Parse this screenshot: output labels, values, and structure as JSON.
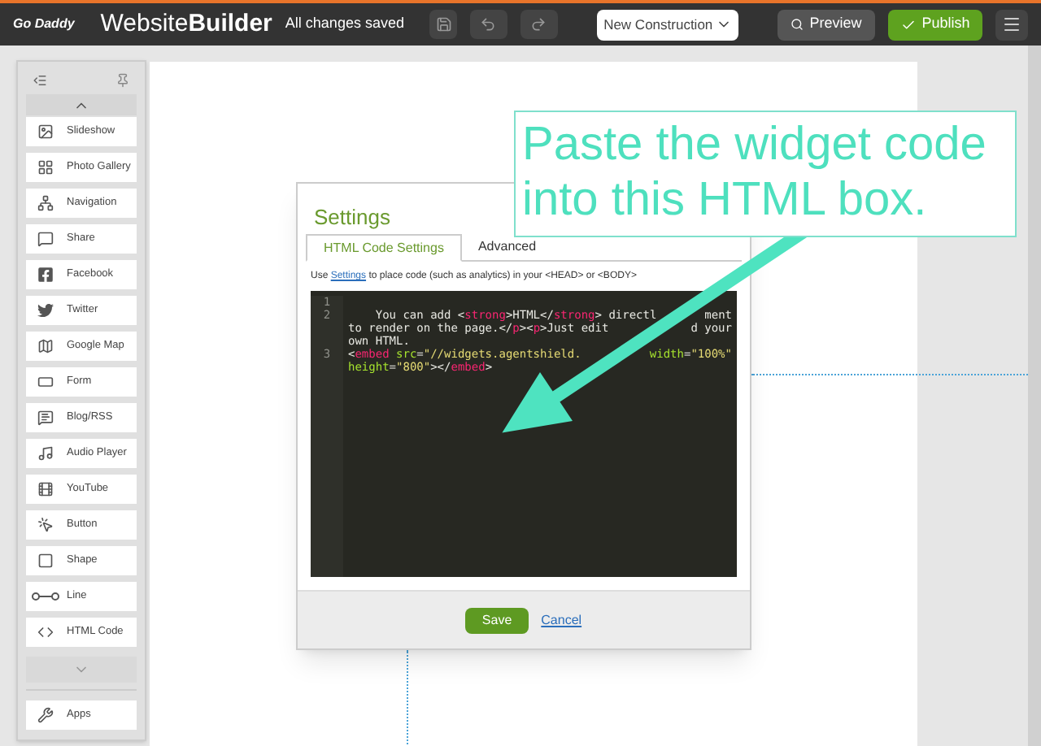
{
  "topbar": {
    "logo": "Go Daddy",
    "title": "Website**Builder**",
    "status": "All changes saved",
    "page_select": "New Construction",
    "preview": "Preview",
    "publish": "Publish"
  },
  "panel": {
    "items": [
      {
        "label": "Slideshow"
      },
      {
        "label": "Photo Gallery"
      },
      {
        "label": "Navigation"
      },
      {
        "label": "Share"
      },
      {
        "label": "Facebook"
      },
      {
        "label": "Twitter"
      },
      {
        "label": "Google Map"
      },
      {
        "label": "Form"
      },
      {
        "label": "Blog/RSS"
      },
      {
        "label": "Audio Player"
      },
      {
        "label": "YouTube"
      },
      {
        "label": "Button"
      },
      {
        "label": "Shape"
      },
      {
        "label": "Line"
      },
      {
        "label": "HTML Code"
      }
    ],
    "apps": "Apps"
  },
  "dialog": {
    "title": "Settings",
    "tabs": [
      {
        "label": "HTML Code Settings",
        "selected": true
      },
      {
        "label": "Advanced",
        "selected": false
      }
    ],
    "hint_before": "Use ",
    "hint_link": "Settings",
    "hint_after": " to place code (such as analytics) in your <HEAD> or <BODY>",
    "code_lines": [
      {
        "number": "1"
      },
      {
        "number": "2",
        "segments": [
          {
            "kind": "text",
            "text": "    You can add <"
          },
          {
            "kind": "tag",
            "text": "strong"
          },
          {
            "kind": "text",
            "text": ">HTML</"
          },
          {
            "kind": "tag",
            "text": "strong"
          },
          {
            "kind": "text",
            "text": "> directl"
          }
        ],
        "tail": [
          {
            "kind": "text",
            "text": "ment"
          }
        ]
      },
      {
        "segments": [
          {
            "kind": "text",
            "text": "to render on the page.</"
          },
          {
            "kind": "tag",
            "text": "p"
          },
          {
            "kind": "text",
            "text": "><"
          },
          {
            "kind": "tag",
            "text": "p"
          },
          {
            "kind": "text",
            "text": ">Just edit"
          }
        ],
        "tail": [
          {
            "kind": "text",
            "text": "d your"
          }
        ]
      },
      {
        "segments": [
          {
            "kind": "text",
            "text": "own HTML."
          }
        ]
      },
      {
        "number": "3",
        "segments": [
          {
            "kind": "text",
            "text": "<"
          },
          {
            "kind": "tag",
            "text": "embed"
          },
          {
            "kind": "attr",
            "text": " src"
          },
          {
            "kind": "text",
            "text": "="
          },
          {
            "kind": "string",
            "text": "\"//widgets.agentshield."
          }
        ],
        "tail": [
          {
            "kind": "attr",
            "text": "width"
          },
          {
            "kind": "text",
            "text": "="
          },
          {
            "kind": "string",
            "text": "\"100%\""
          }
        ]
      },
      {
        "segments": [
          {
            "kind": "attr",
            "text": "height"
          },
          {
            "kind": "text",
            "text": "="
          },
          {
            "kind": "string",
            "text": "\"800\""
          },
          {
            "kind": "text",
            "text": "></"
          },
          {
            "kind": "tag",
            "text": "embed"
          },
          {
            "kind": "text",
            "text": ">"
          }
        ]
      }
    ],
    "save": "Save",
    "cancel": "Cancel"
  },
  "callout": {
    "text": "Paste the widget code into this HTML box."
  }
}
